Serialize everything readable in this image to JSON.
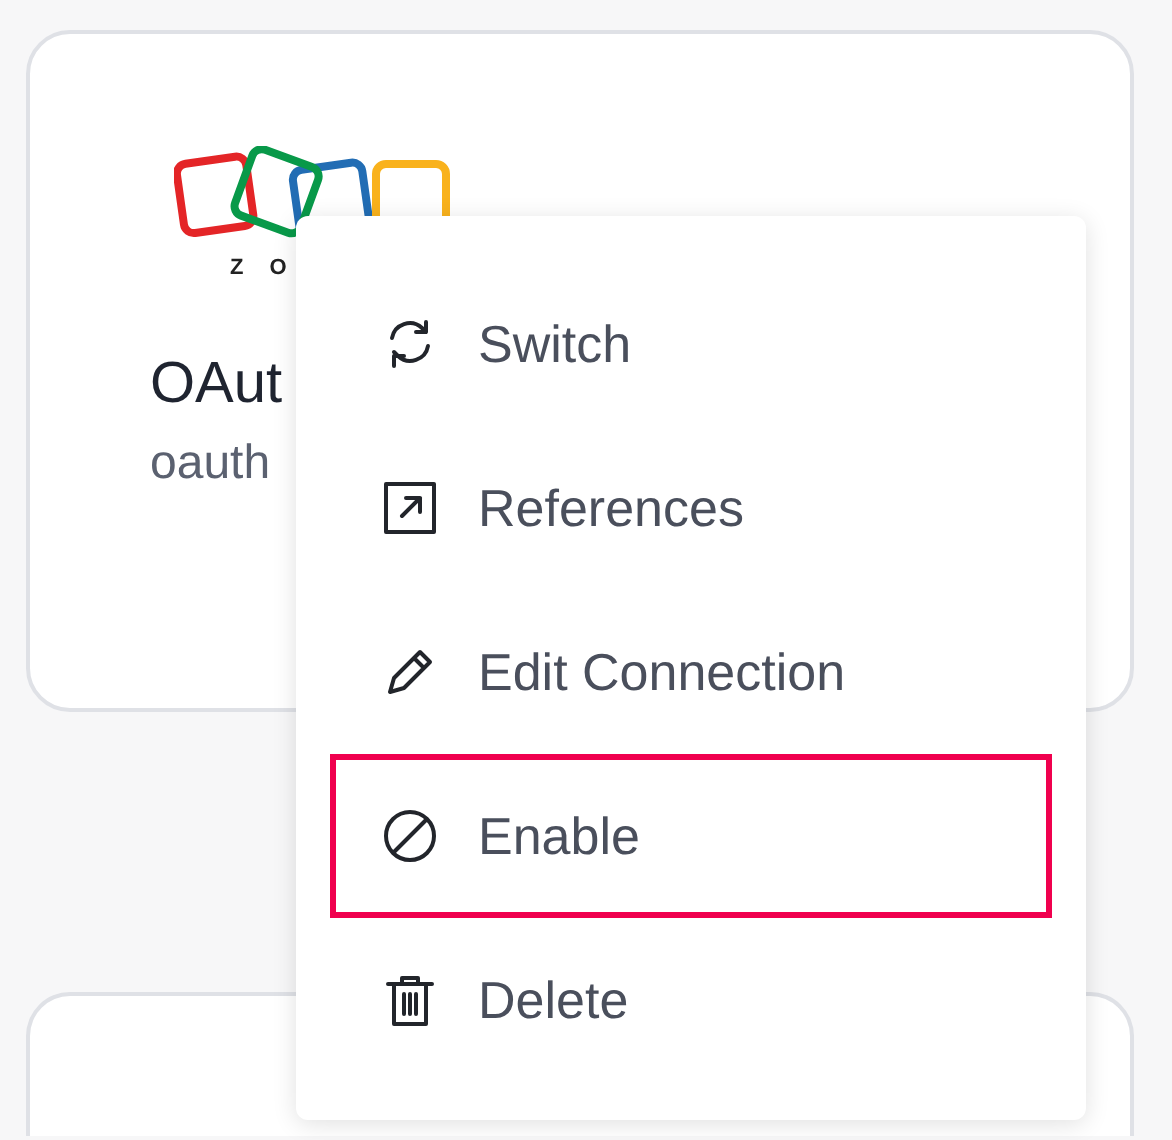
{
  "card": {
    "logo_text": "Z O",
    "title": "OAut",
    "subtitle": "oauth"
  },
  "menu": {
    "items": [
      {
        "kind": "switch",
        "label": "Switch",
        "highlighted": false
      },
      {
        "kind": "references",
        "label": "References",
        "highlighted": false
      },
      {
        "kind": "edit",
        "label": "Edit Connection",
        "highlighted": false
      },
      {
        "kind": "enable",
        "label": "Enable",
        "highlighted": true
      },
      {
        "kind": "delete",
        "label": "Delete",
        "highlighted": false
      }
    ]
  }
}
